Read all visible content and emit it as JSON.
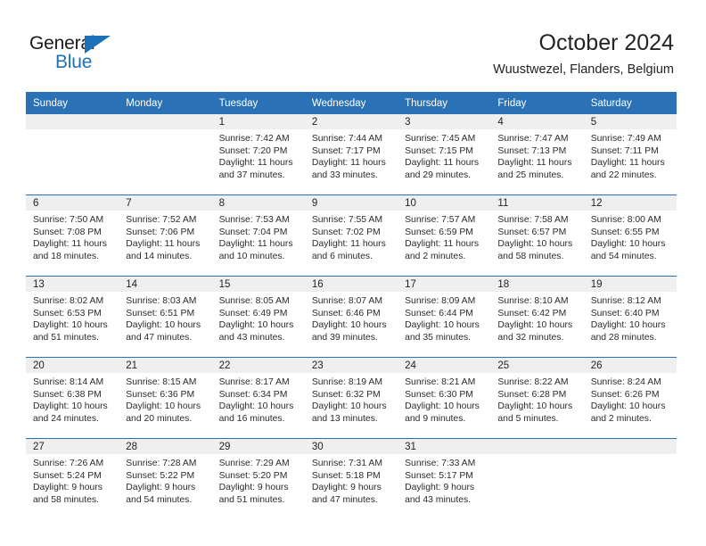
{
  "logo": {
    "word_top": "General",
    "word_bottom": "Blue",
    "triangle_color": "#1b72b8",
    "top_text_color": "#1a1a1a"
  },
  "header": {
    "title": "October 2024",
    "subtitle": "Wuustwezel, Flanders, Belgium"
  },
  "theme": {
    "header_blue": "#2a72b5",
    "date_strip_gray": "#efefef",
    "text_color": "#2b2b2b"
  },
  "calendar": {
    "weekday_headers": [
      "Sunday",
      "Monday",
      "Tuesday",
      "Wednesday",
      "Thursday",
      "Friday",
      "Saturday"
    ],
    "weeks": [
      [
        {
          "day": "",
          "lines": []
        },
        {
          "day": "",
          "lines": []
        },
        {
          "day": "1",
          "lines": [
            "Sunrise: 7:42 AM",
            "Sunset: 7:20 PM",
            "Daylight: 11 hours",
            "and 37 minutes."
          ]
        },
        {
          "day": "2",
          "lines": [
            "Sunrise: 7:44 AM",
            "Sunset: 7:17 PM",
            "Daylight: 11 hours",
            "and 33 minutes."
          ]
        },
        {
          "day": "3",
          "lines": [
            "Sunrise: 7:45 AM",
            "Sunset: 7:15 PM",
            "Daylight: 11 hours",
            "and 29 minutes."
          ]
        },
        {
          "day": "4",
          "lines": [
            "Sunrise: 7:47 AM",
            "Sunset: 7:13 PM",
            "Daylight: 11 hours",
            "and 25 minutes."
          ]
        },
        {
          "day": "5",
          "lines": [
            "Sunrise: 7:49 AM",
            "Sunset: 7:11 PM",
            "Daylight: 11 hours",
            "and 22 minutes."
          ]
        }
      ],
      [
        {
          "day": "6",
          "lines": [
            "Sunrise: 7:50 AM",
            "Sunset: 7:08 PM",
            "Daylight: 11 hours",
            "and 18 minutes."
          ]
        },
        {
          "day": "7",
          "lines": [
            "Sunrise: 7:52 AM",
            "Sunset: 7:06 PM",
            "Daylight: 11 hours",
            "and 14 minutes."
          ]
        },
        {
          "day": "8",
          "lines": [
            "Sunrise: 7:53 AM",
            "Sunset: 7:04 PM",
            "Daylight: 11 hours",
            "and 10 minutes."
          ]
        },
        {
          "day": "9",
          "lines": [
            "Sunrise: 7:55 AM",
            "Sunset: 7:02 PM",
            "Daylight: 11 hours",
            "and 6 minutes."
          ]
        },
        {
          "day": "10",
          "lines": [
            "Sunrise: 7:57 AM",
            "Sunset: 6:59 PM",
            "Daylight: 11 hours",
            "and 2 minutes."
          ]
        },
        {
          "day": "11",
          "lines": [
            "Sunrise: 7:58 AM",
            "Sunset: 6:57 PM",
            "Daylight: 10 hours",
            "and 58 minutes."
          ]
        },
        {
          "day": "12",
          "lines": [
            "Sunrise: 8:00 AM",
            "Sunset: 6:55 PM",
            "Daylight: 10 hours",
            "and 54 minutes."
          ]
        }
      ],
      [
        {
          "day": "13",
          "lines": [
            "Sunrise: 8:02 AM",
            "Sunset: 6:53 PM",
            "Daylight: 10 hours",
            "and 51 minutes."
          ]
        },
        {
          "day": "14",
          "lines": [
            "Sunrise: 8:03 AM",
            "Sunset: 6:51 PM",
            "Daylight: 10 hours",
            "and 47 minutes."
          ]
        },
        {
          "day": "15",
          "lines": [
            "Sunrise: 8:05 AM",
            "Sunset: 6:49 PM",
            "Daylight: 10 hours",
            "and 43 minutes."
          ]
        },
        {
          "day": "16",
          "lines": [
            "Sunrise: 8:07 AM",
            "Sunset: 6:46 PM",
            "Daylight: 10 hours",
            "and 39 minutes."
          ]
        },
        {
          "day": "17",
          "lines": [
            "Sunrise: 8:09 AM",
            "Sunset: 6:44 PM",
            "Daylight: 10 hours",
            "and 35 minutes."
          ]
        },
        {
          "day": "18",
          "lines": [
            "Sunrise: 8:10 AM",
            "Sunset: 6:42 PM",
            "Daylight: 10 hours",
            "and 32 minutes."
          ]
        },
        {
          "day": "19",
          "lines": [
            "Sunrise: 8:12 AM",
            "Sunset: 6:40 PM",
            "Daylight: 10 hours",
            "and 28 minutes."
          ]
        }
      ],
      [
        {
          "day": "20",
          "lines": [
            "Sunrise: 8:14 AM",
            "Sunset: 6:38 PM",
            "Daylight: 10 hours",
            "and 24 minutes."
          ]
        },
        {
          "day": "21",
          "lines": [
            "Sunrise: 8:15 AM",
            "Sunset: 6:36 PM",
            "Daylight: 10 hours",
            "and 20 minutes."
          ]
        },
        {
          "day": "22",
          "lines": [
            "Sunrise: 8:17 AM",
            "Sunset: 6:34 PM",
            "Daylight: 10 hours",
            "and 16 minutes."
          ]
        },
        {
          "day": "23",
          "lines": [
            "Sunrise: 8:19 AM",
            "Sunset: 6:32 PM",
            "Daylight: 10 hours",
            "and 13 minutes."
          ]
        },
        {
          "day": "24",
          "lines": [
            "Sunrise: 8:21 AM",
            "Sunset: 6:30 PM",
            "Daylight: 10 hours",
            "and 9 minutes."
          ]
        },
        {
          "day": "25",
          "lines": [
            "Sunrise: 8:22 AM",
            "Sunset: 6:28 PM",
            "Daylight: 10 hours",
            "and 5 minutes."
          ]
        },
        {
          "day": "26",
          "lines": [
            "Sunrise: 8:24 AM",
            "Sunset: 6:26 PM",
            "Daylight: 10 hours",
            "and 2 minutes."
          ]
        }
      ],
      [
        {
          "day": "27",
          "lines": [
            "Sunrise: 7:26 AM",
            "Sunset: 5:24 PM",
            "Daylight: 9 hours",
            "and 58 minutes."
          ]
        },
        {
          "day": "28",
          "lines": [
            "Sunrise: 7:28 AM",
            "Sunset: 5:22 PM",
            "Daylight: 9 hours",
            "and 54 minutes."
          ]
        },
        {
          "day": "29",
          "lines": [
            "Sunrise: 7:29 AM",
            "Sunset: 5:20 PM",
            "Daylight: 9 hours",
            "and 51 minutes."
          ]
        },
        {
          "day": "30",
          "lines": [
            "Sunrise: 7:31 AM",
            "Sunset: 5:18 PM",
            "Daylight: 9 hours",
            "and 47 minutes."
          ]
        },
        {
          "day": "31",
          "lines": [
            "Sunrise: 7:33 AM",
            "Sunset: 5:17 PM",
            "Daylight: 9 hours",
            "and 43 minutes."
          ]
        },
        {
          "day": "",
          "lines": []
        },
        {
          "day": "",
          "lines": []
        }
      ]
    ]
  }
}
